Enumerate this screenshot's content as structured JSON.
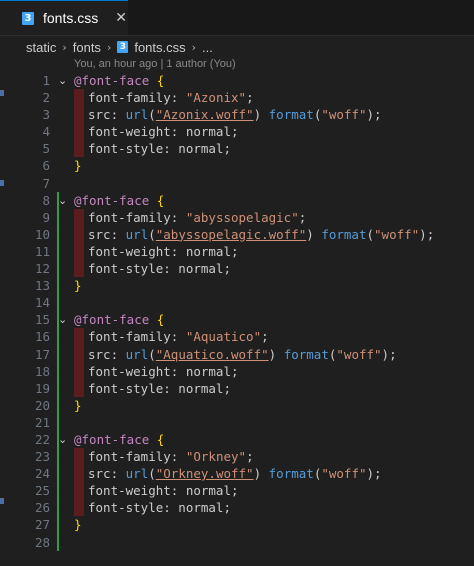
{
  "tab": {
    "label": "fonts.css",
    "icon": "css-file-icon",
    "close": "✕"
  },
  "breadcrumb": {
    "items": [
      "static",
      "fonts",
      "fonts.css",
      "..."
    ]
  },
  "blame": "You, an hour ago | 1 author (You)",
  "code": {
    "lines": [
      {
        "n": "1",
        "type": "open",
        "text": "@font-face {"
      },
      {
        "n": "2",
        "type": "family",
        "value": "\"Azonix\""
      },
      {
        "n": "3",
        "type": "src",
        "value": "\"Azonix.woff\"",
        "format": "\"woff\""
      },
      {
        "n": "4",
        "type": "weight"
      },
      {
        "n": "5",
        "type": "style"
      },
      {
        "n": "6",
        "type": "close"
      },
      {
        "n": "7",
        "type": "blank"
      },
      {
        "n": "8",
        "type": "open"
      },
      {
        "n": "9",
        "type": "family",
        "value": "\"abyssopelagic\""
      },
      {
        "n": "10",
        "type": "src",
        "value": "\"abyssopelagic.woff\"",
        "format": "\"woff\""
      },
      {
        "n": "11",
        "type": "weight"
      },
      {
        "n": "12",
        "type": "style"
      },
      {
        "n": "13",
        "type": "close"
      },
      {
        "n": "14",
        "type": "blank"
      },
      {
        "n": "15",
        "type": "open"
      },
      {
        "n": "16",
        "type": "family",
        "value": "\"Aquatico\""
      },
      {
        "n": "17",
        "type": "src",
        "value": "\"Aquatico.woff\"",
        "format": "\"woff\""
      },
      {
        "n": "18",
        "type": "weight"
      },
      {
        "n": "19",
        "type": "style"
      },
      {
        "n": "20",
        "type": "close"
      },
      {
        "n": "21",
        "type": "blank"
      },
      {
        "n": "22",
        "type": "open"
      },
      {
        "n": "23",
        "type": "family",
        "value": "\"Orkney\""
      },
      {
        "n": "24",
        "type": "src",
        "value": "\"Orkney.woff\"",
        "format": "\"woff\""
      },
      {
        "n": "25",
        "type": "weight"
      },
      {
        "n": "26",
        "type": "style"
      },
      {
        "n": "27",
        "type": "close"
      },
      {
        "n": "28",
        "type": "blank"
      }
    ],
    "keywords": {
      "at_rule": "@font-face",
      "family": "font-family:",
      "src": "src:",
      "url": "url",
      "format": "format",
      "weight": "font-weight: normal;",
      "style": "font-style: normal;"
    }
  },
  "colors": {
    "accent": "#0078d4",
    "added": "#2ea043",
    "string": "#ce9178",
    "keyword": "#c586c0",
    "brace": "#ffd700"
  }
}
